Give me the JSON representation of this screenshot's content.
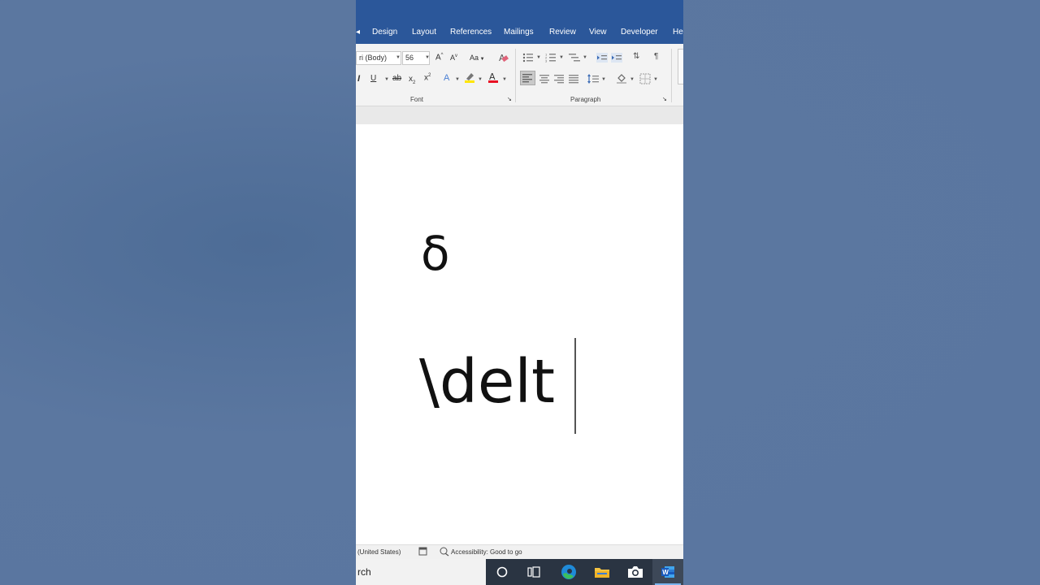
{
  "tabs": [
    "Design",
    "Layout",
    "References",
    "Mailings",
    "Review",
    "View",
    "Developer",
    "He"
  ],
  "ribbon": {
    "font_name": "ri (Body)",
    "font_size": "56",
    "change_case_label": "Aa",
    "font_group_label": "Font",
    "paragraph_group_label": "Paragraph"
  },
  "document": {
    "line1": "δ",
    "line2": "\\delt"
  },
  "status": {
    "language": "(United States)",
    "accessibility": "Accessibility: Good to go"
  },
  "taskbar": {
    "search_text": "rch"
  },
  "colors": {
    "word_blue": "#2b579a",
    "highlight_yellow": "#ffe600",
    "font_color_red": "#e81123",
    "edge_blue": "#1f8ad8",
    "edge_green": "#3cbf5b",
    "folder_yellow": "#f5c342",
    "word_icon_blue": "#185abd"
  }
}
